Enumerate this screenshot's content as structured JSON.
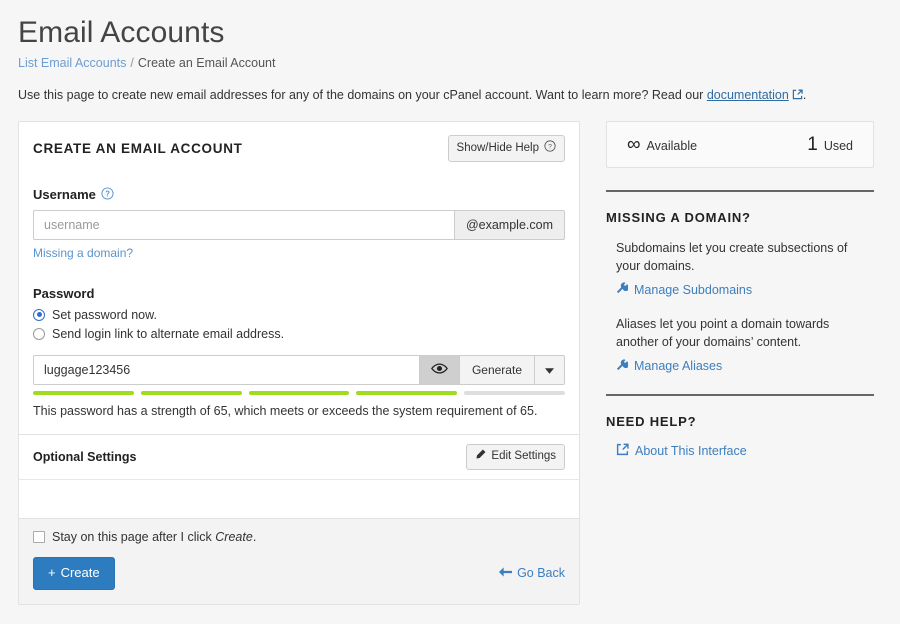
{
  "header": {
    "title": "Email Accounts",
    "breadcrumb_link": "List Email Accounts",
    "breadcrumb_sep": "/",
    "breadcrumb_current": "Create an Email Account",
    "intro_before": "Use this page to create new email addresses for any of the domains on your cPanel account. Want to learn more? Read our ",
    "intro_link": "documentation",
    "intro_after": "."
  },
  "form": {
    "panel_title": "CREATE AN EMAIL ACCOUNT",
    "help_toggle_label": "Show/Hide Help",
    "username_label": "Username",
    "username_value": "",
    "username_placeholder": "username",
    "domain_addon": "@example.com",
    "missing_domain_link": "Missing a domain?",
    "password_label": "Password",
    "radio_set_now": "Set password now.",
    "radio_send_link": "Send login link to alternate email address.",
    "password_value": "luggage123456",
    "generate_label": "Generate",
    "strength_text": "This password has a strength of 65, which meets or exceeds the system requirement of 65.",
    "strength_value": 65,
    "strength_segments_filled": 4,
    "strength_segments_total": 5,
    "strength_color": "#9fdc20",
    "optional_settings_title": "Optional Settings",
    "edit_settings_label": "Edit Settings",
    "stay_checkbox_before": "Stay on this page after I click ",
    "stay_checkbox_em": "Create",
    "stay_checkbox_after": ".",
    "create_label": "Create",
    "go_back_label": "Go Back"
  },
  "sidebar": {
    "available_value": "∞",
    "available_label": "Available",
    "used_value": "1",
    "used_label": "Used",
    "missing_domain_heading": "MISSING A DOMAIN?",
    "subdomain_text": "Subdomains let you create subsections of your domains.",
    "manage_subdomains_label": "Manage Subdomains",
    "aliases_text": "Aliases let you point a domain towards another of your domains’ content.",
    "manage_aliases_label": "Manage Aliases",
    "need_help_heading": "NEED HELP?",
    "about_interface_label": "About This Interface"
  },
  "colors": {
    "primary": "#2e7cc0",
    "link": "#3c7ebf",
    "strength_green": "#9fdc20"
  }
}
